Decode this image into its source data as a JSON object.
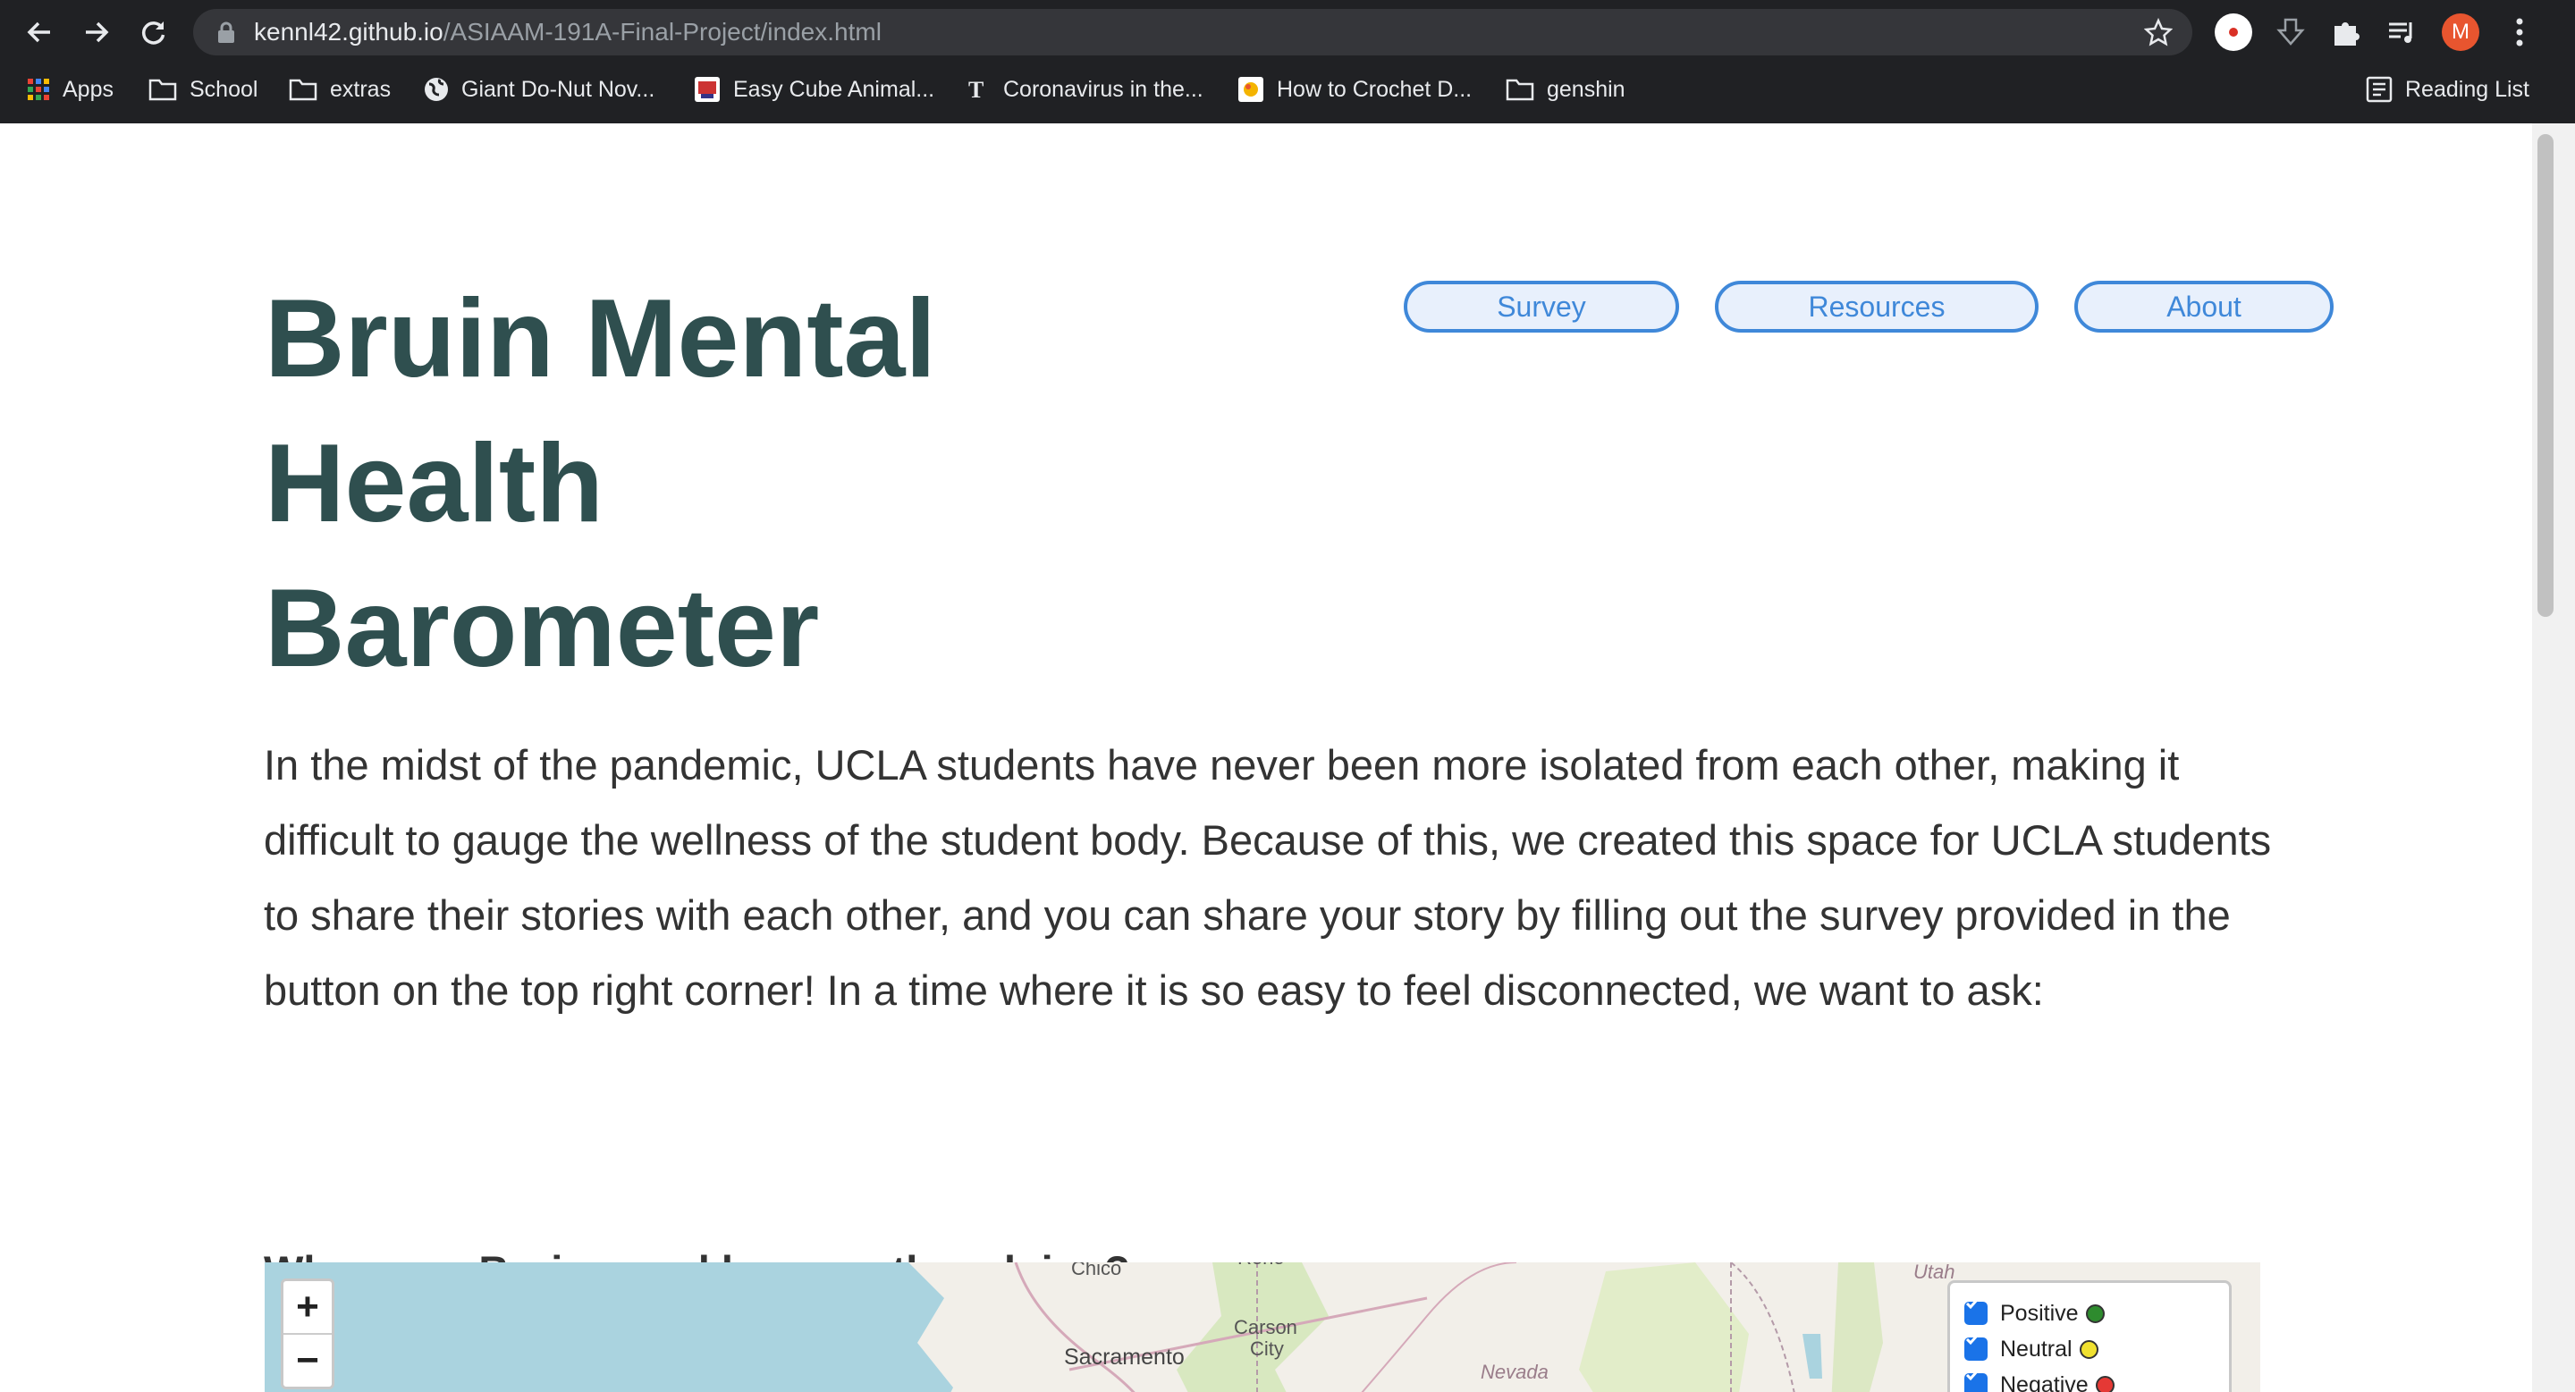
{
  "browser": {
    "url_host": "kennl42.github.io",
    "url_path": "/ASIAAM-191A-Final-Project/index.html",
    "profile_initial": "M",
    "bookmarks": [
      {
        "label": "Apps",
        "icon": "apps-grid-icon"
      },
      {
        "label": "School",
        "icon": "folder-icon"
      },
      {
        "label": "extras",
        "icon": "folder-icon"
      },
      {
        "label": "Giant Do-Nut Nov...",
        "icon": "globe-icon"
      },
      {
        "label": "Easy Cube Animal...",
        "icon": "site-favicon-icon"
      },
      {
        "label": "Coronavirus in the...",
        "icon": "nyt-icon"
      },
      {
        "label": "How to Crochet D...",
        "icon": "site-favicon-icon"
      },
      {
        "label": "genshin",
        "icon": "folder-icon"
      }
    ],
    "reading_list": "Reading List"
  },
  "page": {
    "title_lines": [
      "Bruin Mental",
      "Health",
      "Barometer"
    ],
    "nav": {
      "survey": "Survey",
      "resources": "Resources",
      "about": "About"
    },
    "intro": "In the midst of the pandemic, UCLA students have never been more isolated from each other, making it difficult to gauge the wellness of the student body. Because of this, we created this space for UCLA students to share their stories with each other, and you can share your story by filling out the survey provided in the button on the top right corner! In a time where it is so easy to feel disconnected, we want to ask:",
    "question": "Where are Bruins, and how are they doing?"
  },
  "map": {
    "zoom_in": "+",
    "zoom_out": "−",
    "labels": {
      "chico": "Chico",
      "reno": "Reno",
      "carson": "Carson",
      "city": "City",
      "sacramento": "Sacramento",
      "nevada": "Nevada",
      "utah": "Utah"
    },
    "legend": [
      {
        "label": "Positive",
        "color": "#2e8b2e"
      },
      {
        "label": "Neutral",
        "color": "#f0e130"
      },
      {
        "label": "Negative",
        "color": "#e53935"
      }
    ]
  },
  "colors": {
    "title": "#2f4f4f",
    "nav_button": "#3f88d9",
    "text": "#333333"
  }
}
